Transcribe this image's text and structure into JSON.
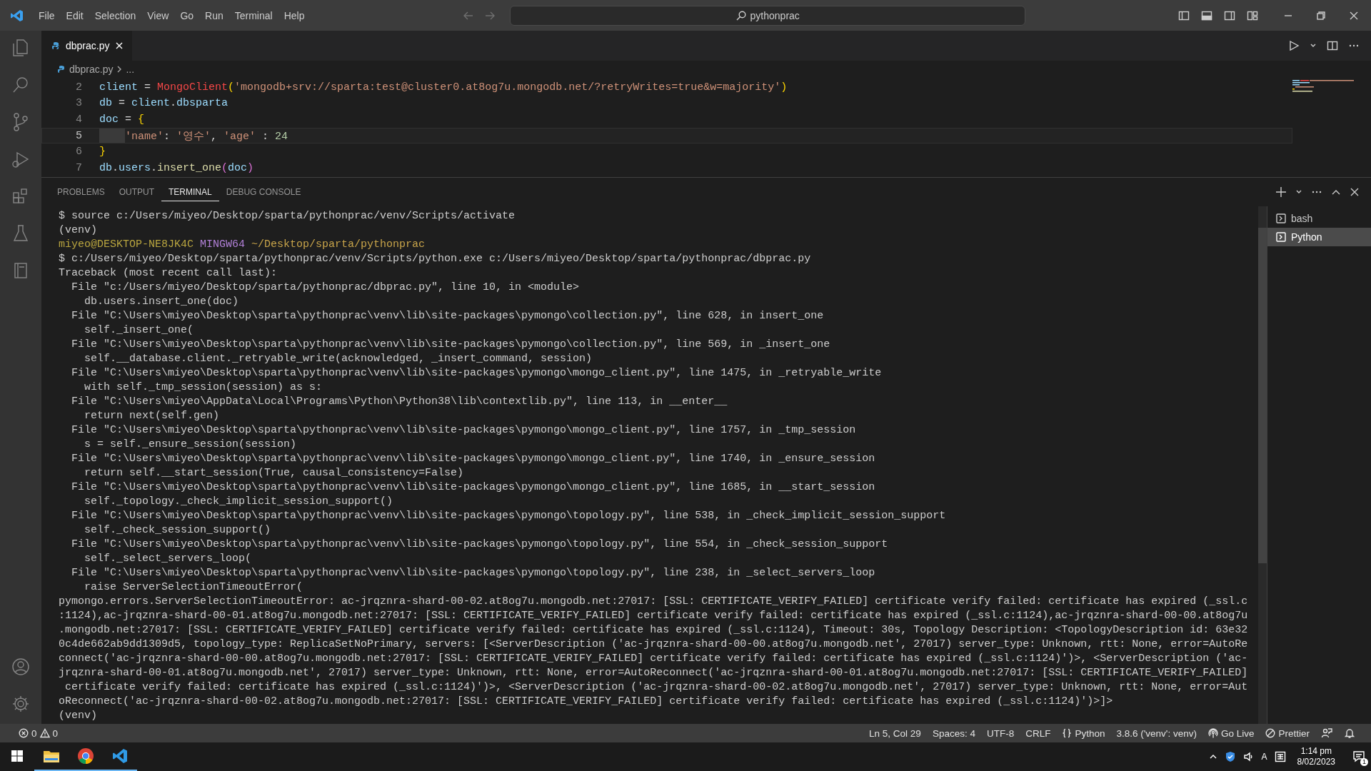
{
  "title_bar": {
    "menu": [
      "File",
      "Edit",
      "Selection",
      "View",
      "Go",
      "Run",
      "Terminal",
      "Help"
    ],
    "search": "pythonprac"
  },
  "editor": {
    "tab": {
      "label": "dbprac.py",
      "selected": true
    },
    "breadcrumb": [
      "dbprac.py",
      "..."
    ],
    "lines": [
      {
        "number": "2",
        "current": false,
        "indented": false,
        "tokens": [
          {
            "kind": "var",
            "text": "client"
          },
          {
            "kind": "op",
            "text": " = "
          },
          {
            "kind": "err",
            "text": "MongoClient"
          },
          {
            "kind": "bracket1",
            "text": "("
          },
          {
            "kind": "str",
            "text": "'mongodb+srv://sparta:test@cluster0.at8og7u.mongodb.net/?retryWrites=true&w=majority'"
          },
          {
            "kind": "bracket1",
            "text": ")"
          }
        ]
      },
      {
        "number": "3",
        "current": false,
        "indented": false,
        "tokens": [
          {
            "kind": "var",
            "text": "db"
          },
          {
            "kind": "op",
            "text": " = "
          },
          {
            "kind": "var",
            "text": "client"
          },
          {
            "kind": "op",
            "text": "."
          },
          {
            "kind": "var",
            "text": "dbsparta"
          }
        ]
      },
      {
        "number": "4",
        "current": false,
        "indented": false,
        "tokens": [
          {
            "kind": "var",
            "text": "doc"
          },
          {
            "kind": "op",
            "text": " = "
          },
          {
            "kind": "bracket1",
            "text": "{"
          }
        ]
      },
      {
        "number": "5",
        "current": true,
        "indented": true,
        "tokens": [
          {
            "kind": "str",
            "text": "'name'"
          },
          {
            "kind": "op",
            "text": ": "
          },
          {
            "kind": "str",
            "text": "'영수'"
          },
          {
            "kind": "op",
            "text": ", "
          },
          {
            "kind": "str",
            "text": "'age'"
          },
          {
            "kind": "op",
            "text": " : "
          },
          {
            "kind": "num",
            "text": "24"
          }
        ]
      },
      {
        "number": "6",
        "current": false,
        "indented": false,
        "tokens": [
          {
            "kind": "bracket1",
            "text": "}"
          }
        ]
      },
      {
        "number": "7",
        "current": false,
        "indented": false,
        "tokens": [
          {
            "kind": "var",
            "text": "db"
          },
          {
            "kind": "op",
            "text": "."
          },
          {
            "kind": "var",
            "text": "users"
          },
          {
            "kind": "op",
            "text": "."
          },
          {
            "kind": "func",
            "text": "insert_one"
          },
          {
            "kind": "bracket2",
            "text": "("
          },
          {
            "kind": "var",
            "text": "doc"
          },
          {
            "kind": "bracket2",
            "text": ")"
          }
        ]
      }
    ]
  },
  "panel": {
    "tabs": [
      {
        "label": "PROBLEMS",
        "selected": false
      },
      {
        "label": "OUTPUT",
        "selected": false
      },
      {
        "label": "TERMINAL",
        "selected": true
      },
      {
        "label": "DEBUG CONSOLE",
        "selected": false
      }
    ],
    "terminal_lines": [
      {
        "kind": "plain",
        "text": "$ source c:/Users/miyeo/Desktop/sparta/pythonprac/venv/Scripts/activate"
      },
      {
        "kind": "plain",
        "text": "(venv)"
      },
      {
        "kind": "prompt",
        "user": "miyeo@DESKTOP-NE8JK4C",
        "shell": "MINGW64",
        "path": "~/Desktop/sparta/pythonprac"
      },
      {
        "kind": "plain",
        "text": "$ c:/Users/miyeo/Desktop/sparta/pythonprac/venv/Scripts/python.exe c:/Users/miyeo/Desktop/sparta/pythonprac/dbprac.py"
      },
      {
        "kind": "plain",
        "text": "Traceback (most recent call last):"
      },
      {
        "kind": "plain",
        "text": "  File \"c:/Users/miyeo/Desktop/sparta/pythonprac/dbprac.py\", line 10, in <module>"
      },
      {
        "kind": "plain",
        "text": "    db.users.insert_one(doc)"
      },
      {
        "kind": "plain",
        "text": "  File \"C:\\Users\\miyeo\\Desktop\\sparta\\pythonprac\\venv\\lib\\site-packages\\pymongo\\collection.py\", line 628, in insert_one"
      },
      {
        "kind": "plain",
        "text": "    self._insert_one("
      },
      {
        "kind": "plain",
        "text": "  File \"C:\\Users\\miyeo\\Desktop\\sparta\\pythonprac\\venv\\lib\\site-packages\\pymongo\\collection.py\", line 569, in _insert_one"
      },
      {
        "kind": "plain",
        "text": "    self.__database.client._retryable_write(acknowledged, _insert_command, session)"
      },
      {
        "kind": "plain",
        "text": "  File \"C:\\Users\\miyeo\\Desktop\\sparta\\pythonprac\\venv\\lib\\site-packages\\pymongo\\mongo_client.py\", line 1475, in _retryable_write"
      },
      {
        "kind": "plain",
        "text": "    with self._tmp_session(session) as s:"
      },
      {
        "kind": "plain",
        "text": "  File \"C:\\Users\\miyeo\\AppData\\Local\\Programs\\Python\\Python38\\lib\\contextlib.py\", line 113, in __enter__"
      },
      {
        "kind": "plain",
        "text": "    return next(self.gen)"
      },
      {
        "kind": "plain",
        "text": "  File \"C:\\Users\\miyeo\\Desktop\\sparta\\pythonprac\\venv\\lib\\site-packages\\pymongo\\mongo_client.py\", line 1757, in _tmp_session"
      },
      {
        "kind": "plain",
        "text": "    s = self._ensure_session(session)"
      },
      {
        "kind": "plain",
        "text": "  File \"C:\\Users\\miyeo\\Desktop\\sparta\\pythonprac\\venv\\lib\\site-packages\\pymongo\\mongo_client.py\", line 1740, in _ensure_session"
      },
      {
        "kind": "plain",
        "text": "    return self.__start_session(True, causal_consistency=False)"
      },
      {
        "kind": "plain",
        "text": "  File \"C:\\Users\\miyeo\\Desktop\\sparta\\pythonprac\\venv\\lib\\site-packages\\pymongo\\mongo_client.py\", line 1685, in __start_session"
      },
      {
        "kind": "plain",
        "text": "    self._topology._check_implicit_session_support()"
      },
      {
        "kind": "plain",
        "text": "  File \"C:\\Users\\miyeo\\Desktop\\sparta\\pythonprac\\venv\\lib\\site-packages\\pymongo\\topology.py\", line 538, in _check_implicit_session_support"
      },
      {
        "kind": "plain",
        "text": "    self._check_session_support()"
      },
      {
        "kind": "plain",
        "text": "  File \"C:\\Users\\miyeo\\Desktop\\sparta\\pythonprac\\venv\\lib\\site-packages\\pymongo\\topology.py\", line 554, in _check_session_support"
      },
      {
        "kind": "plain",
        "text": "    self._select_servers_loop("
      },
      {
        "kind": "plain",
        "text": "  File \"C:\\Users\\miyeo\\Desktop\\sparta\\pythonprac\\venv\\lib\\site-packages\\pymongo\\topology.py\", line 238, in _select_servers_loop"
      },
      {
        "kind": "plain",
        "text": "    raise ServerSelectionTimeoutError("
      },
      {
        "kind": "plain",
        "text": "pymongo.errors.ServerSelectionTimeoutError: ac-jrqznra-shard-00-02.at8og7u.mongodb.net:27017: [SSL: CERTIFICATE_VERIFY_FAILED] certificate verify failed: certificate has expired (_ssl.c"
      },
      {
        "kind": "plain",
        "text": ":1124),ac-jrqznra-shard-00-01.at8og7u.mongodb.net:27017: [SSL: CERTIFICATE_VERIFY_FAILED] certificate verify failed: certificate has expired (_ssl.c:1124),ac-jrqznra-shard-00-00.at8og7u"
      },
      {
        "kind": "plain",
        "text": ".mongodb.net:27017: [SSL: CERTIFICATE_VERIFY_FAILED] certificate verify failed: certificate has expired (_ssl.c:1124), Timeout: 30s, Topology Description: <TopologyDescription id: 63e32"
      },
      {
        "kind": "plain",
        "text": "0c4de662ab9dd1309d5, topology_type: ReplicaSetNoPrimary, servers: [<ServerDescription ('ac-jrqznra-shard-00-00.at8og7u.mongodb.net', 27017) server_type: Unknown, rtt: None, error=AutoRe"
      },
      {
        "kind": "plain",
        "text": "connect('ac-jrqznra-shard-00-00.at8og7u.mongodb.net:27017: [SSL: CERTIFICATE_VERIFY_FAILED] certificate verify failed: certificate has expired (_ssl.c:1124)')>, <ServerDescription ('ac-"
      },
      {
        "kind": "plain",
        "text": "jrqznra-shard-00-01.at8og7u.mongodb.net', 27017) server_type: Unknown, rtt: None, error=AutoReconnect('ac-jrqznra-shard-00-01.at8og7u.mongodb.net:27017: [SSL: CERTIFICATE_VERIFY_FAILED]"
      },
      {
        "kind": "plain",
        "text": " certificate verify failed: certificate has expired (_ssl.c:1124)')>, <ServerDescription ('ac-jrqznra-shard-00-02.at8og7u.mongodb.net', 27017) server_type: Unknown, rtt: None, error=Aut"
      },
      {
        "kind": "plain",
        "text": "oReconnect('ac-jrqznra-shard-00-02.at8og7u.mongodb.net:27017: [SSL: CERTIFICATE_VERIFY_FAILED] certificate verify failed: certificate has expired (_ssl.c:1124)')>]>"
      },
      {
        "kind": "plain",
        "text": "(venv)"
      }
    ],
    "terminals": [
      {
        "label": "bash",
        "selected": false
      },
      {
        "label": "Python",
        "selected": true
      }
    ]
  },
  "status_bar": {
    "errors": "0",
    "warnings": "0",
    "items": [
      {
        "kind": "text",
        "text": "Ln 5, Col 29"
      },
      {
        "kind": "text",
        "text": "Spaces: 4"
      },
      {
        "kind": "text",
        "text": "UTF-8"
      },
      {
        "kind": "text",
        "text": "CRLF"
      },
      {
        "kind": "language",
        "text": "Python"
      },
      {
        "kind": "text",
        "text": "3.8.6 ('venv': venv)"
      },
      {
        "kind": "golive",
        "text": "Go Live"
      },
      {
        "kind": "prettier",
        "text": "Prettier"
      }
    ]
  },
  "taskbar": {
    "input_indicator": "A",
    "time": "1:14 pm",
    "date": "8/02/2023",
    "notifications": "1"
  }
}
